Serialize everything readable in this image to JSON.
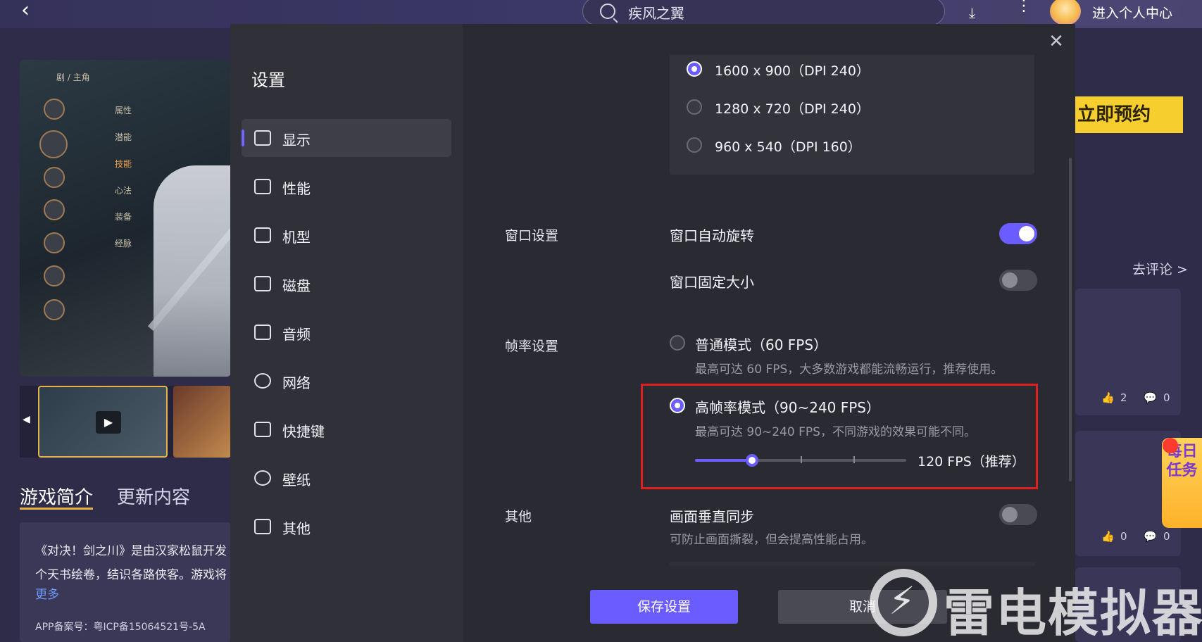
{
  "topbar": {
    "search_text": "疾风之翼",
    "user_label": "进入个人中心",
    "back_glyph": "‹",
    "download_glyph": "⤓",
    "more_glyph": "⋮"
  },
  "background": {
    "game_menu": [
      "属性",
      "潜能",
      "技能",
      "心法",
      "装备",
      "经脉"
    ],
    "game_menu_header": "剧 / 主角",
    "tabs": {
      "intro": "游戏简介",
      "update": "更新内容"
    },
    "intro_text_line1": "《对决！剑之川》是由汉家松鼠开发",
    "intro_text_line2": "个天书绘卷，结识各路侠客。游戏将",
    "more_link": "更多",
    "icp": "APP备案号：粤ICP备15064521号-5A",
    "reserve_button": "立即预约",
    "comment_link": "去评论 >",
    "stats": [
      {
        "likes": "2",
        "comments": "0"
      },
      {
        "likes": "0",
        "comments": "0"
      }
    ],
    "daily_task": "每日任务"
  },
  "settings": {
    "title": "设置",
    "nav": [
      {
        "label": "显示",
        "active": true
      },
      {
        "label": "性能"
      },
      {
        "label": "机型"
      },
      {
        "label": "磁盘"
      },
      {
        "label": "音频"
      },
      {
        "label": "网络"
      },
      {
        "label": "快捷键"
      },
      {
        "label": "壁纸"
      },
      {
        "label": "其他"
      }
    ],
    "resolutions": [
      {
        "label": "1600 x 900（DPI 240）",
        "selected": true
      },
      {
        "label": "1280 x 720（DPI 240）",
        "selected": false
      },
      {
        "label": "960 x 540（DPI 160）",
        "selected": false
      }
    ],
    "window": {
      "section": "窗口设置",
      "auto_rotate": {
        "label": "窗口自动旋转",
        "on": true
      },
      "fixed_size": {
        "label": "窗口固定大小",
        "on": false
      }
    },
    "fps": {
      "section": "帧率设置",
      "normal": {
        "label": "普通模式（60 FPS）",
        "desc": "最高可达 60 FPS，大多数游戏都能流畅运行，推荐使用。",
        "selected": false
      },
      "high": {
        "label": "高帧率模式（90~240 FPS）",
        "desc": "最高可达 90~240 FPS，不同游戏的效果可能不同。",
        "selected": true
      },
      "slider": {
        "value_label": "120 FPS（推荐）",
        "level": 0.27
      }
    },
    "other": {
      "section": "其他",
      "vsync": {
        "label": "画面垂直同步",
        "desc": "可防止画面撕裂，但会提高性能占用。",
        "on": false
      }
    },
    "save_button": "保存设置",
    "cancel_button": "取消",
    "close_glyph": "✕"
  },
  "watermark": {
    "text": "雷电模拟器",
    "bolt": "⚡"
  },
  "colors": {
    "accent": "#6a5cff",
    "highlight": "#e02020",
    "reserve": "#f6cf2f"
  }
}
